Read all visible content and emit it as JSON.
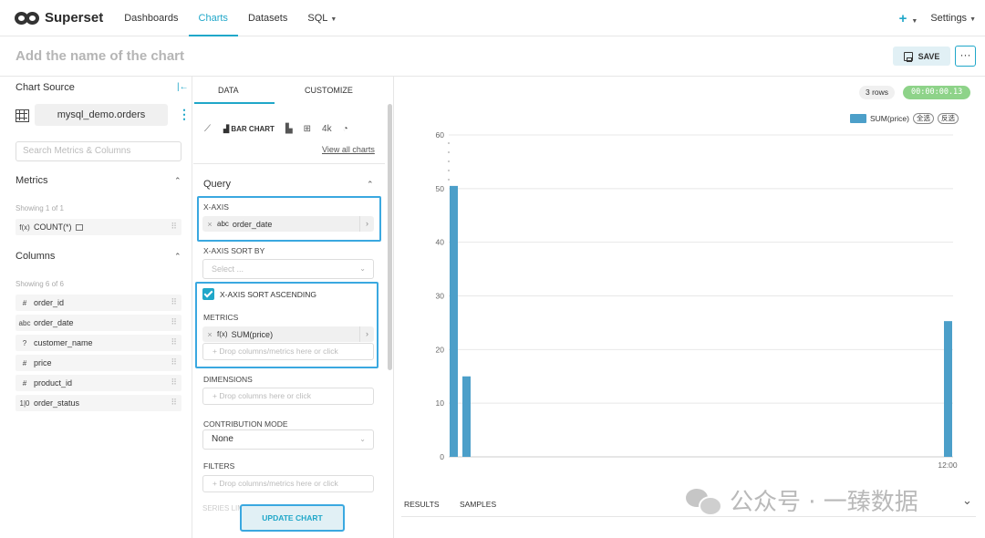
{
  "nav": {
    "brand": "Superset",
    "items": [
      "Dashboards",
      "Charts",
      "Datasets",
      "SQL"
    ],
    "plus_label": "+",
    "settings_label": "Settings"
  },
  "header": {
    "chart_name_placeholder": "Add the name of the chart",
    "save_label": "SAVE",
    "more_label": "···"
  },
  "datasource": {
    "title": "Chart Source",
    "name": "mysql_demo.orders",
    "search_placeholder": "Search Metrics & Columns",
    "metrics_title": "Metrics",
    "metrics_showing": "Showing 1 of 1",
    "metrics": [
      {
        "type": "f(x)",
        "name": "COUNT(*)"
      }
    ],
    "columns_title": "Columns",
    "columns_showing": "Showing 6 of 6",
    "columns": [
      {
        "type": "#",
        "name": "order_id"
      },
      {
        "type": "abc",
        "name": "order_date"
      },
      {
        "type": "?",
        "name": "customer_name"
      },
      {
        "type": "#",
        "name": "price"
      },
      {
        "type": "#",
        "name": "product_id"
      },
      {
        "type": "1|0",
        "name": "order_status"
      }
    ]
  },
  "controls": {
    "tabs": [
      "DATA",
      "CUSTOMIZE"
    ],
    "viz_type_label": "BAR CHART",
    "viz_4k": "4k",
    "view_all": "View all charts",
    "query_title": "Query",
    "x_axis_label": "X-AXIS",
    "x_axis_type": "abc",
    "x_axis_value": "order_date",
    "x_axis_sort_label": "X-AXIS SORT BY",
    "x_axis_sort_placeholder": "Select ...",
    "sort_ascending_label": "X-AXIS SORT ASCENDING",
    "metrics_label": "METRICS",
    "metric_value": "SUM(price)",
    "metric_drop": "Drop columns/metrics here or click",
    "dimensions_label": "DIMENSIONS",
    "dimensions_drop": "Drop columns here or click",
    "contribution_label": "CONTRIBUTION MODE",
    "contribution_value": "None",
    "filters_label": "FILTERS",
    "filters_drop": "Drop columns/metrics here or click",
    "series_limit_label": "SERIES LIMIT",
    "update_label": "UPDATE CHART"
  },
  "result": {
    "rows_badge": "3 rows",
    "time_badge": "00:00:00.13",
    "tabs": [
      "RESULTS",
      "SAMPLES"
    ]
  },
  "legend": {
    "series_name": "SUM(price)",
    "select_all": "全选",
    "invert": "反选"
  },
  "colors": {
    "accent": "#20a7c9",
    "bar": "#4c9fc9",
    "highlight": "#3aa8e0",
    "time_badge": "#8ed389"
  },
  "chart_data": {
    "type": "bar",
    "title": "",
    "xlabel": "",
    "ylabel": "",
    "ylim": [
      0,
      60
    ],
    "yticks": [
      0,
      10,
      20,
      30,
      40,
      50,
      60
    ],
    "x_tick_labels": [
      "12:00"
    ],
    "series": [
      {
        "name": "SUM(price)",
        "values": [
          50.5,
          15,
          25.3
        ]
      }
    ],
    "legend_position": "top-right",
    "grid": true
  },
  "watermark": "公众号 · 一臻数据"
}
